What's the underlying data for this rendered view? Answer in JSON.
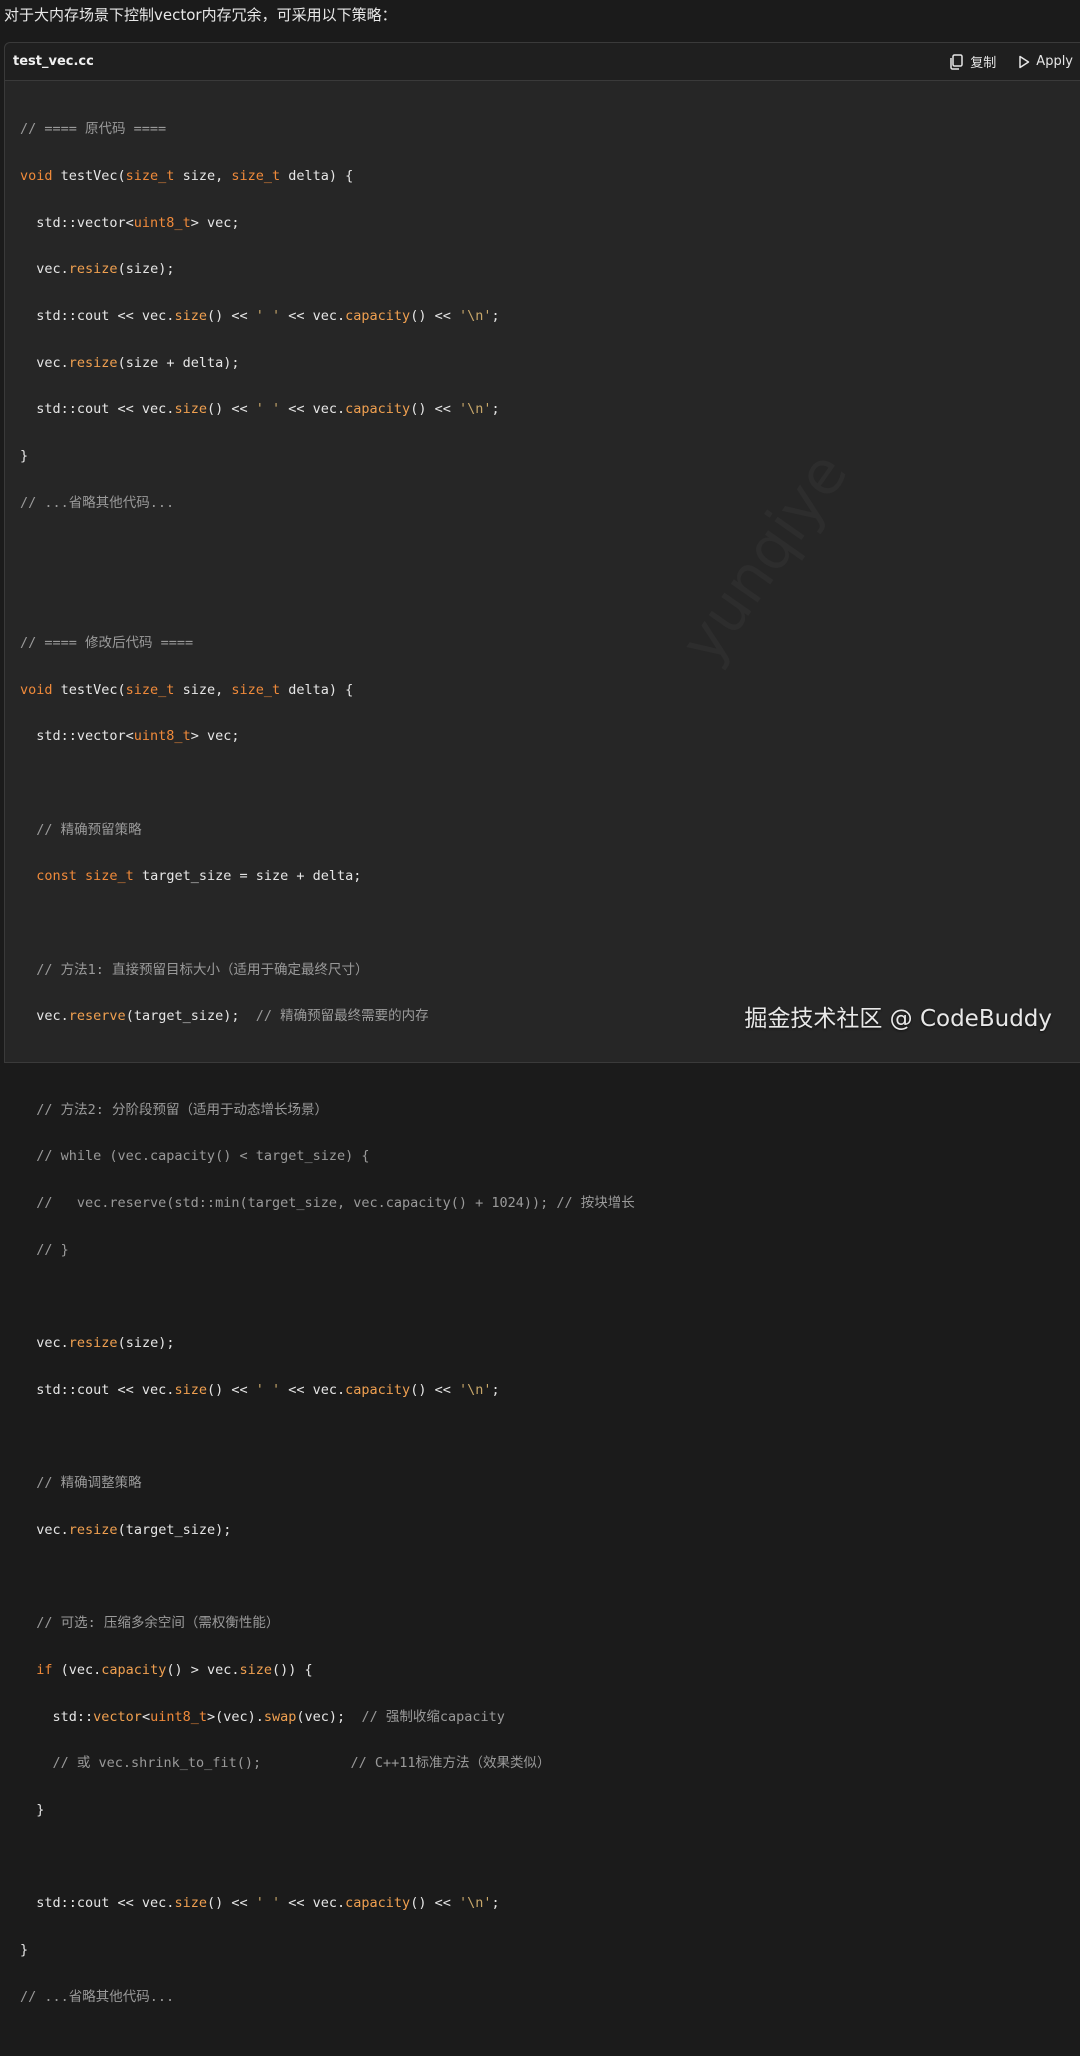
{
  "intro": "对于大内存场景下控制vector内存冗余，可采用以下策略：",
  "header": {
    "file_name": "test_vec.cc",
    "copy_label": "复制",
    "apply_label": "Apply"
  },
  "code": {
    "l01": "// ==== 原代码 ====",
    "l02a": "void",
    "l02b": " testVec(",
    "l02c": "size_t",
    "l02d": " size, ",
    "l02e": "size_t",
    "l02f": " delta) {",
    "l03a": "  std::vector<",
    "l03b": "uint8_t",
    "l03c": "> vec;",
    "l04a": "  vec.",
    "l04b": "resize",
    "l04c": "(size);",
    "l05a": "  std::cout << vec.",
    "l05b": "size",
    "l05c": "() << ",
    "l05d": "' '",
    "l05e": " << vec.",
    "l05f": "capacity",
    "l05g": "() << ",
    "l05h": "'\\n'",
    "l05i": ";",
    "l06a": "  vec.",
    "l06b": "resize",
    "l06c": "(size + delta);",
    "l07a": "  std::cout << vec.",
    "l07b": "size",
    "l07c": "() << ",
    "l07d": "' '",
    "l07e": " << vec.",
    "l07f": "capacity",
    "l07g": "() << ",
    "l07h": "'\\n'",
    "l07i": ";",
    "l08": "}",
    "l09": "// ...省略其他代码...",
    "l12": "// ==== 修改后代码 ====",
    "l13a": "void",
    "l13b": " testVec(",
    "l13c": "size_t",
    "l13d": " size, ",
    "l13e": "size_t",
    "l13f": " delta) {",
    "l14a": "  std::vector<",
    "l14b": "uint8_t",
    "l14c": "> vec;",
    "l16": "  // 精确预留策略",
    "l17a": "  const",
    "l17b": " ",
    "l17c": "size_t",
    "l17d": " target_size = size + delta;",
    "l19": "  // 方法1: 直接预留目标大小（适用于确定最终尺寸）",
    "l20a": "  vec.",
    "l20b": "reserve",
    "l20c": "(target_size);  ",
    "l20d": "// 精确预留最终需要的内存",
    "l22": "  // 方法2: 分阶段预留（适用于动态增长场景）",
    "l23": "  // while (vec.capacity() < target_size) {",
    "l24": "  //   vec.reserve(std::min(target_size, vec.capacity() + 1024)); // 按块增长",
    "l25": "  // }",
    "l27a": "  vec.",
    "l27b": "resize",
    "l27c": "(size);",
    "l28a": "  std::cout << vec.",
    "l28b": "size",
    "l28c": "() << ",
    "l28d": "' '",
    "l28e": " << vec.",
    "l28f": "capacity",
    "l28g": "() << ",
    "l28h": "'\\n'",
    "l28i": ";",
    "l30": "  // 精确调整策略",
    "l31a": "  vec.",
    "l31b": "resize",
    "l31c": "(target_size);",
    "l33": "  // 可选: 压缩多余空间（需权衡性能）",
    "l34a": "  if",
    "l34b": " (vec.",
    "l34c": "capacity",
    "l34d": "() > vec.",
    "l34e": "size",
    "l34f": "()) {",
    "l35a": "    std::",
    "l35b": "vector",
    "l35c": "<",
    "l35d": "uint8_t",
    "l35e": ">(vec).",
    "l35f": "swap",
    "l35g": "(vec);  ",
    "l35h": "// 强制收缩capacity",
    "l36": "    // 或 vec.shrink_to_fit();           // C++11标准方法（效果类似）",
    "l37": "  }",
    "l39a": "  std::cout << vec.",
    "l39b": "size",
    "l39c": "() << ",
    "l39d": "' '",
    "l39e": " << vec.",
    "l39f": "capacity",
    "l39g": "() << ",
    "l39h": "'\\n'",
    "l39i": ";",
    "l40": "}",
    "l41": "// ...省略其他代码..."
  },
  "watermark": "掘金技术社区 @ CodeBuddy",
  "faint_mark": "yunqiye",
  "colors": {
    "background": "#1b1b1b",
    "panel": "#262626",
    "keyword": "#f08a3a",
    "comment": "#9a9a9a",
    "string": "#c8a76a"
  }
}
